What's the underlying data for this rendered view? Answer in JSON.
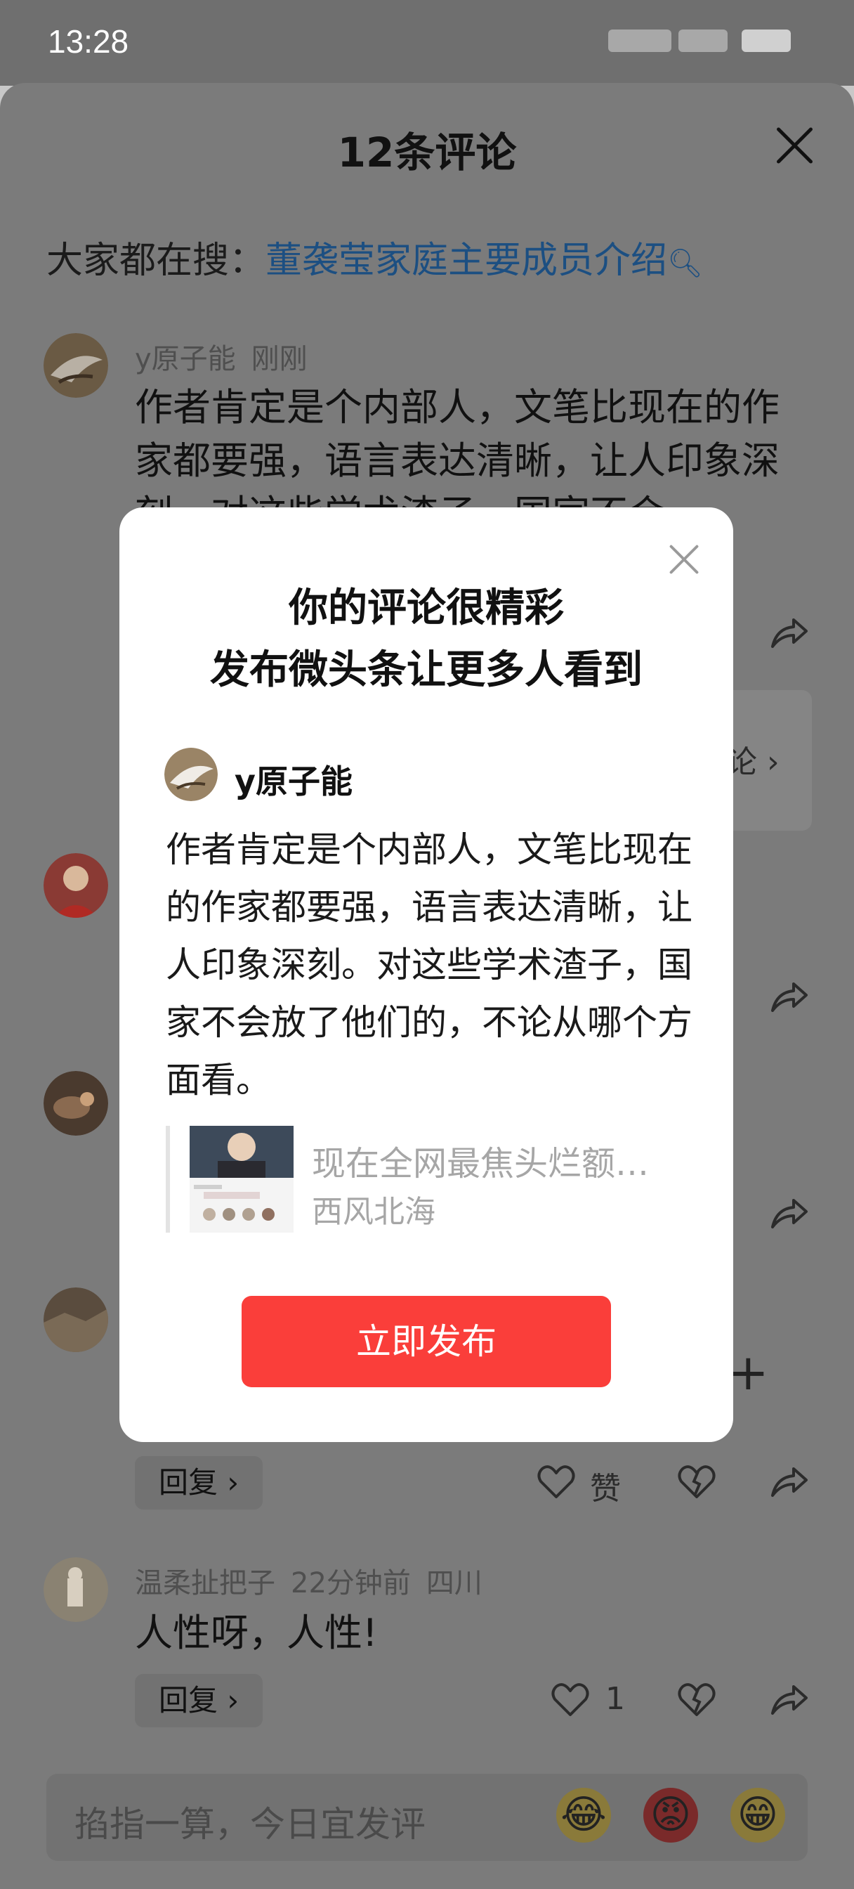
{
  "status_bar": {
    "time": "13:28"
  },
  "sheet": {
    "title": "12条评论",
    "hot_search_prefix": "大家都在搜：",
    "hot_search_term": "董袭莹家庭主要成员介绍"
  },
  "comments": [
    {
      "user": "y原子能",
      "time": "刚刚",
      "text": "作者肯定是个内部人，文笔比现在的作家都要强，语言表达清晰，让人印象深刻。对这些学术渣子，国家不会"
    },
    {
      "user": "温柔扯把子",
      "time": "22分钟前",
      "location": "四川",
      "text": "人性呀，人性!",
      "reply_label": "回复 ›",
      "like_count": "1"
    }
  ],
  "hidden_comment": {
    "reply_label": "回复 ›",
    "like_label": "赞"
  },
  "more_card_label": "论 ›",
  "input_bar": {
    "placeholder": "掐指一算，今日宜发评"
  },
  "modal": {
    "title_line1": "你的评论很精彩",
    "title_line2": "发布微头条让更多人看到",
    "user": "y原子能",
    "text": "作者肯定是个内部人，文笔比现在的作家都要强，语言表达清晰，让人印象深刻。对这些学术渣子，国家不会放了他们的，不论从哪个方面看。",
    "quote_title": "现在全网最焦头烂额…",
    "quote_author": "西风北海",
    "publish_label": "立即发布"
  }
}
